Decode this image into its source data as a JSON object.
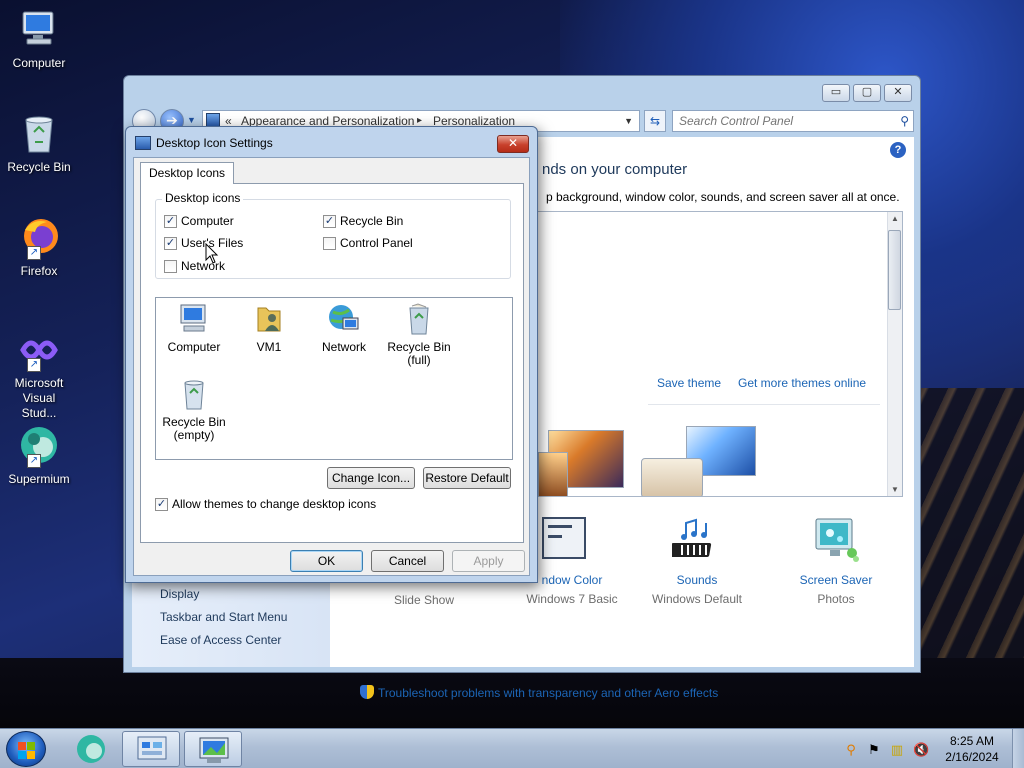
{
  "desktop": {
    "icons": [
      {
        "label": "Computer",
        "icon": "computer-icon"
      },
      {
        "label": "Recycle Bin",
        "icon": "recycle-bin-icon"
      },
      {
        "label": "Firefox",
        "icon": "firefox-icon"
      },
      {
        "label": "Microsoft Visual Stud...",
        "icon": "visual-studio-icon"
      },
      {
        "label": "Supermium",
        "icon": "supermium-icon"
      }
    ]
  },
  "control_panel": {
    "address": {
      "chevrons": "«",
      "crumb1": "Appearance and Personalization",
      "sep": "▸",
      "crumb2": "Personalization"
    },
    "search_placeholder": "Search Control Panel",
    "heading": "nds on your computer",
    "subheading": "p background, window color, sounds, and screen saver all at once.",
    "save_theme": "Save theme",
    "get_more_themes": "Get more themes online",
    "left_links": [
      "Display",
      "Taskbar and Start Menu",
      "Ease of Access Center"
    ],
    "bottom_items": [
      {
        "title": "",
        "subtitle": "Slide Show"
      },
      {
        "title": "ndow Color",
        "subtitle": "Windows 7 Basic"
      },
      {
        "title": "Sounds",
        "subtitle": "Windows Default"
      },
      {
        "title": "Screen Saver",
        "subtitle": "Photos"
      }
    ],
    "troubleshoot": "Troubleshoot problems with transparency and other Aero effects"
  },
  "dialog": {
    "title": "Desktop Icon Settings",
    "close_label": "✕",
    "tab": "Desktop Icons",
    "group_label": "Desktop icons",
    "checkboxes": [
      {
        "label": "Computer",
        "checked": true
      },
      {
        "label": "Recycle Bin",
        "checked": true
      },
      {
        "label": "User's Files",
        "checked": true
      },
      {
        "label": "Control Panel",
        "checked": false
      },
      {
        "label": "Network",
        "checked": false
      }
    ],
    "icon_items": [
      {
        "line1": "Computer",
        "line2": ""
      },
      {
        "line1": "VM1",
        "line2": ""
      },
      {
        "line1": "Network",
        "line2": ""
      },
      {
        "line1": "Recycle Bin",
        "line2": "(full)"
      },
      {
        "line1": "Recycle Bin",
        "line2": "(empty)"
      }
    ],
    "change_icon": "Change Icon...",
    "restore_default": "Restore Default",
    "allow_themes": "Allow themes to change desktop icons",
    "allow_themes_checked": true,
    "ok": "OK",
    "cancel": "Cancel",
    "apply": "Apply"
  },
  "window_buttons": {
    "minimize": "▭",
    "maximize": "▢",
    "close": "✕"
  },
  "taskbar": {
    "time": "8:25 AM",
    "date": "2/16/2024"
  }
}
